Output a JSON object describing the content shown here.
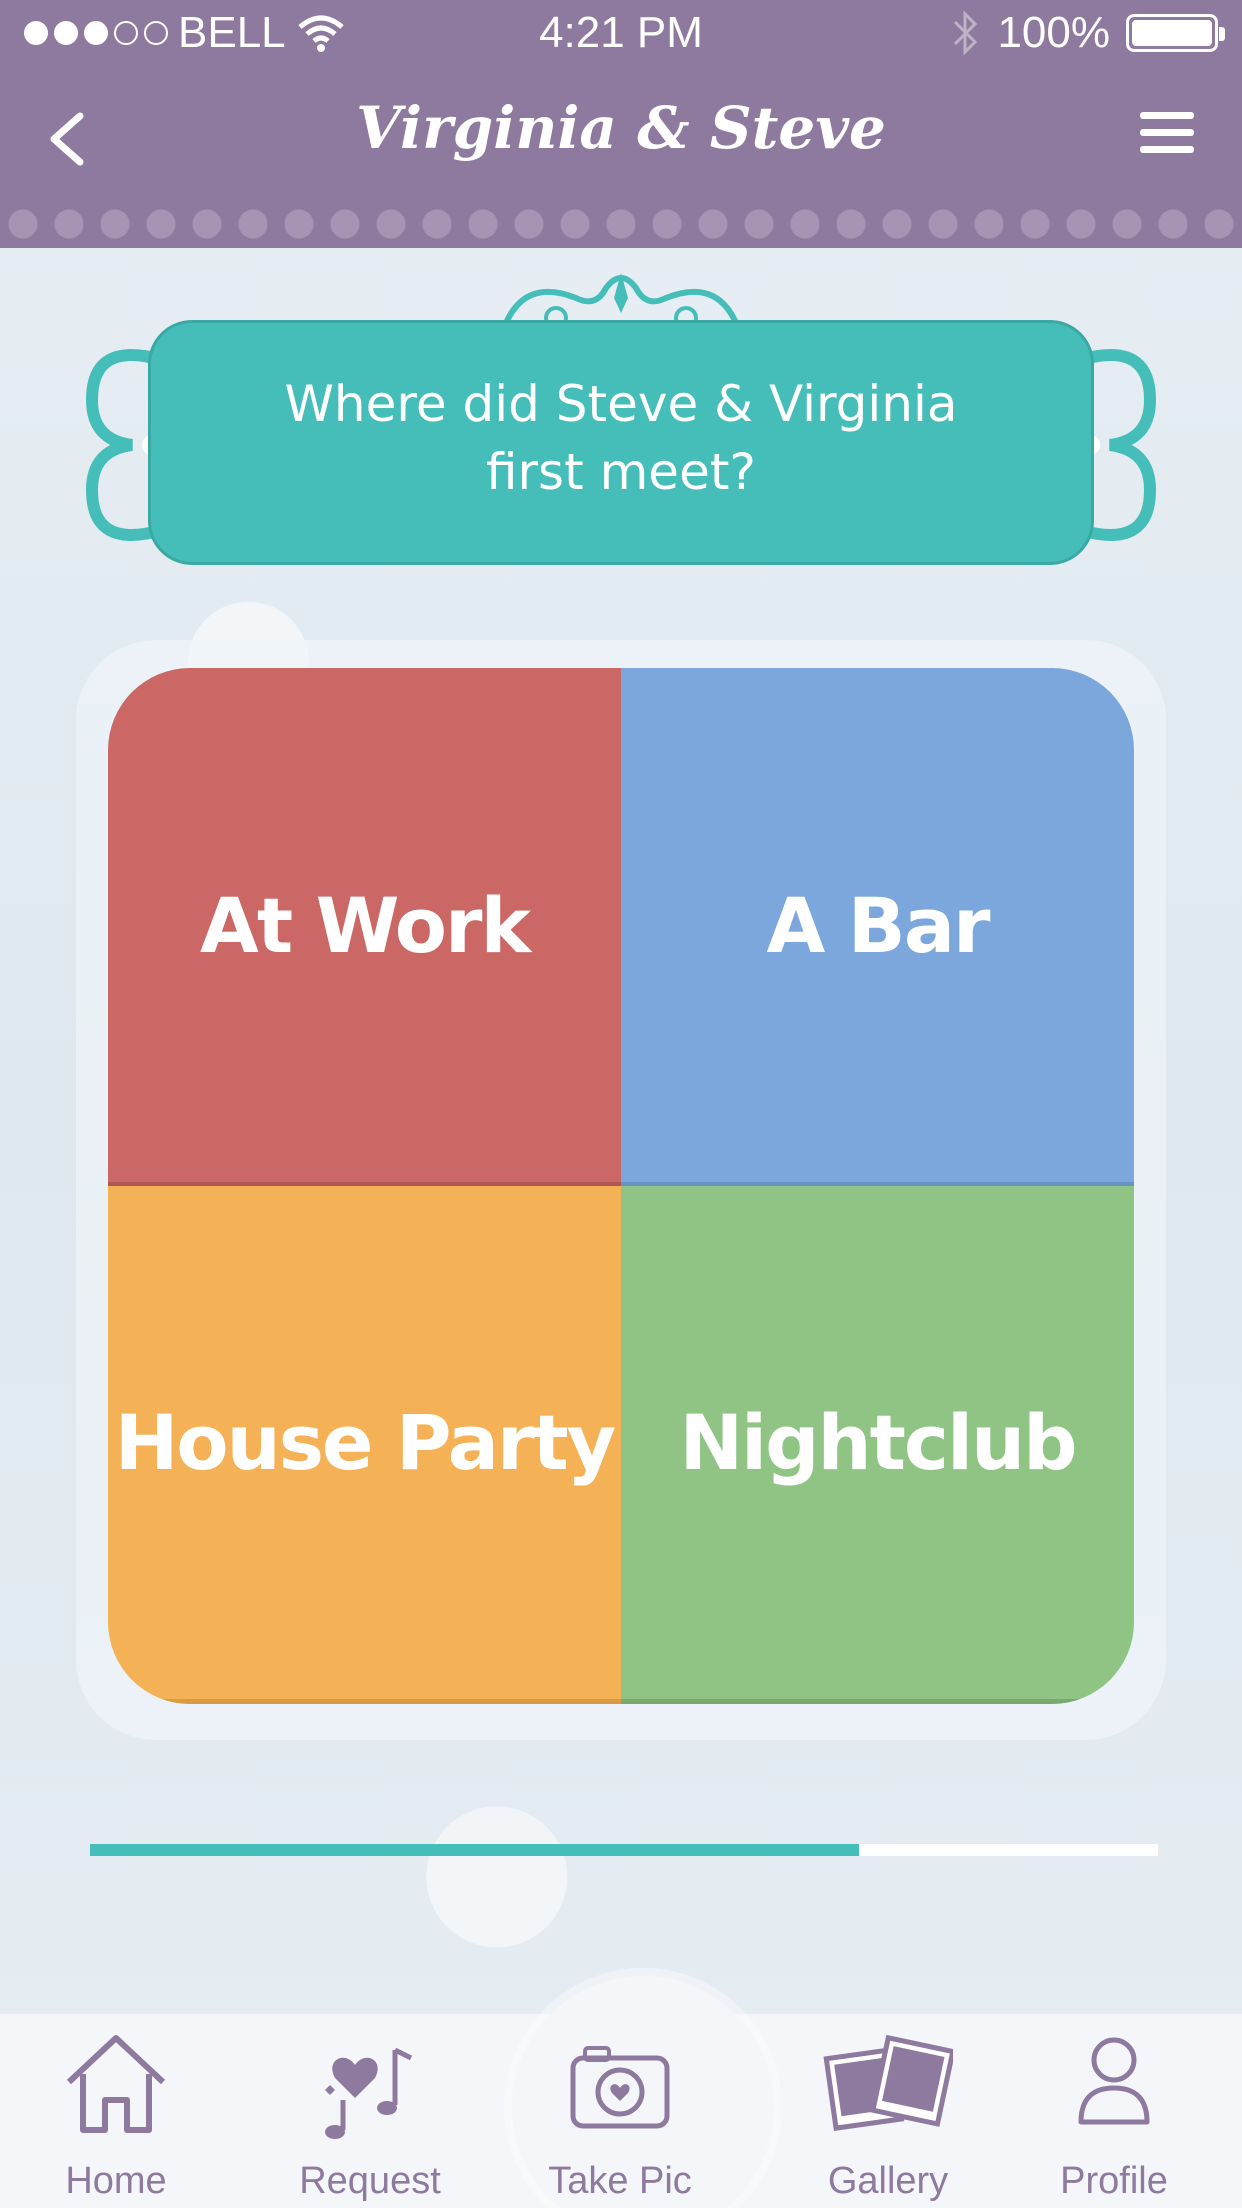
{
  "status_bar": {
    "carrier": "BELL",
    "time": "4:21 PM",
    "battery": "100%",
    "signal_bars_filled": 3,
    "signal_bars_total": 5
  },
  "nav": {
    "title": "Virginia & Steve",
    "back_icon": "chevron-left-icon",
    "menu_icon": "hamburger-icon"
  },
  "question": {
    "line1": "Where did Steve & Virginia",
    "line2": "first meet?"
  },
  "answers": [
    {
      "label": "At Work",
      "color": "#cb6765"
    },
    {
      "label": "A Bar",
      "color": "#7ba7dd"
    },
    {
      "label": "House Party",
      "color": "#f5b155"
    },
    {
      "label": "Nightclub",
      "color": "#8fc485"
    }
  ],
  "progress": {
    "fraction": 0.72,
    "color": "#45beb9"
  },
  "tabs": [
    {
      "label": "Home",
      "icon": "home-icon"
    },
    {
      "label": "Request",
      "icon": "music-hearts-icon"
    },
    {
      "label": "Take Pic",
      "icon": "camera-heart-icon"
    },
    {
      "label": "Gallery",
      "icon": "photos-icon"
    },
    {
      "label": "Profile",
      "icon": "person-icon"
    }
  ],
  "colors": {
    "header": "#8e7a9e",
    "accent": "#45beb9",
    "tab_icon": "#8e7a9e"
  }
}
